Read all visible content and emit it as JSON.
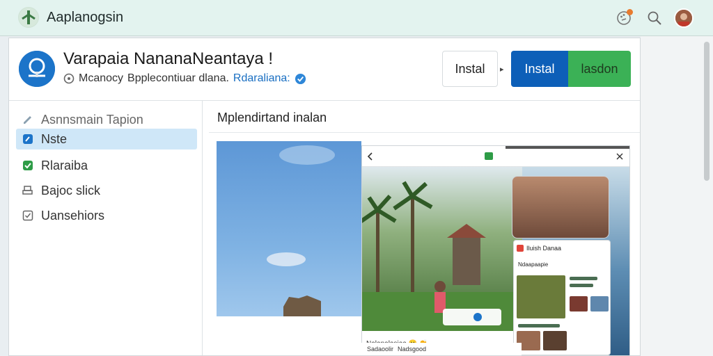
{
  "topbar": {
    "brand": "Aaplanogsin",
    "icons": [
      "palette-icon",
      "search-icon",
      "user-avatar"
    ]
  },
  "header": {
    "title": "Varapaia NananaNeantaya !",
    "meta_prefix": "Mcanocy",
    "meta_text": "Bpplecontiuar dlana.",
    "meta_link": "Rdaraliana:",
    "btn_ghost": "Instal",
    "btn_primary": "Instal",
    "btn_secondary": "lasdon"
  },
  "sidebar": {
    "items": [
      {
        "label": "Asnnsmain Tapion",
        "icon": "pencil-icon"
      },
      {
        "label": "Nste",
        "icon": "edit-icon"
      },
      {
        "label": "Rlaraiba",
        "icon": "check-icon"
      },
      {
        "label": "Bajoc slick",
        "icon": "printer-icon"
      },
      {
        "label": "Uansehiors",
        "icon": "checkbox-icon"
      }
    ]
  },
  "content": {
    "title": "Mplendirtand inalan",
    "phone_caption": "Nalanalasiaa 🙂 👏",
    "small_title": "Iluish Danaa",
    "small_sub": "Ndaapaapie",
    "bottom_a": "Sadaoolir",
    "bottom_b": "Nadsgood"
  },
  "colors": {
    "primary": "#0d5fb8",
    "secondary": "#3bb156",
    "active_bg": "#cfe7f8"
  }
}
